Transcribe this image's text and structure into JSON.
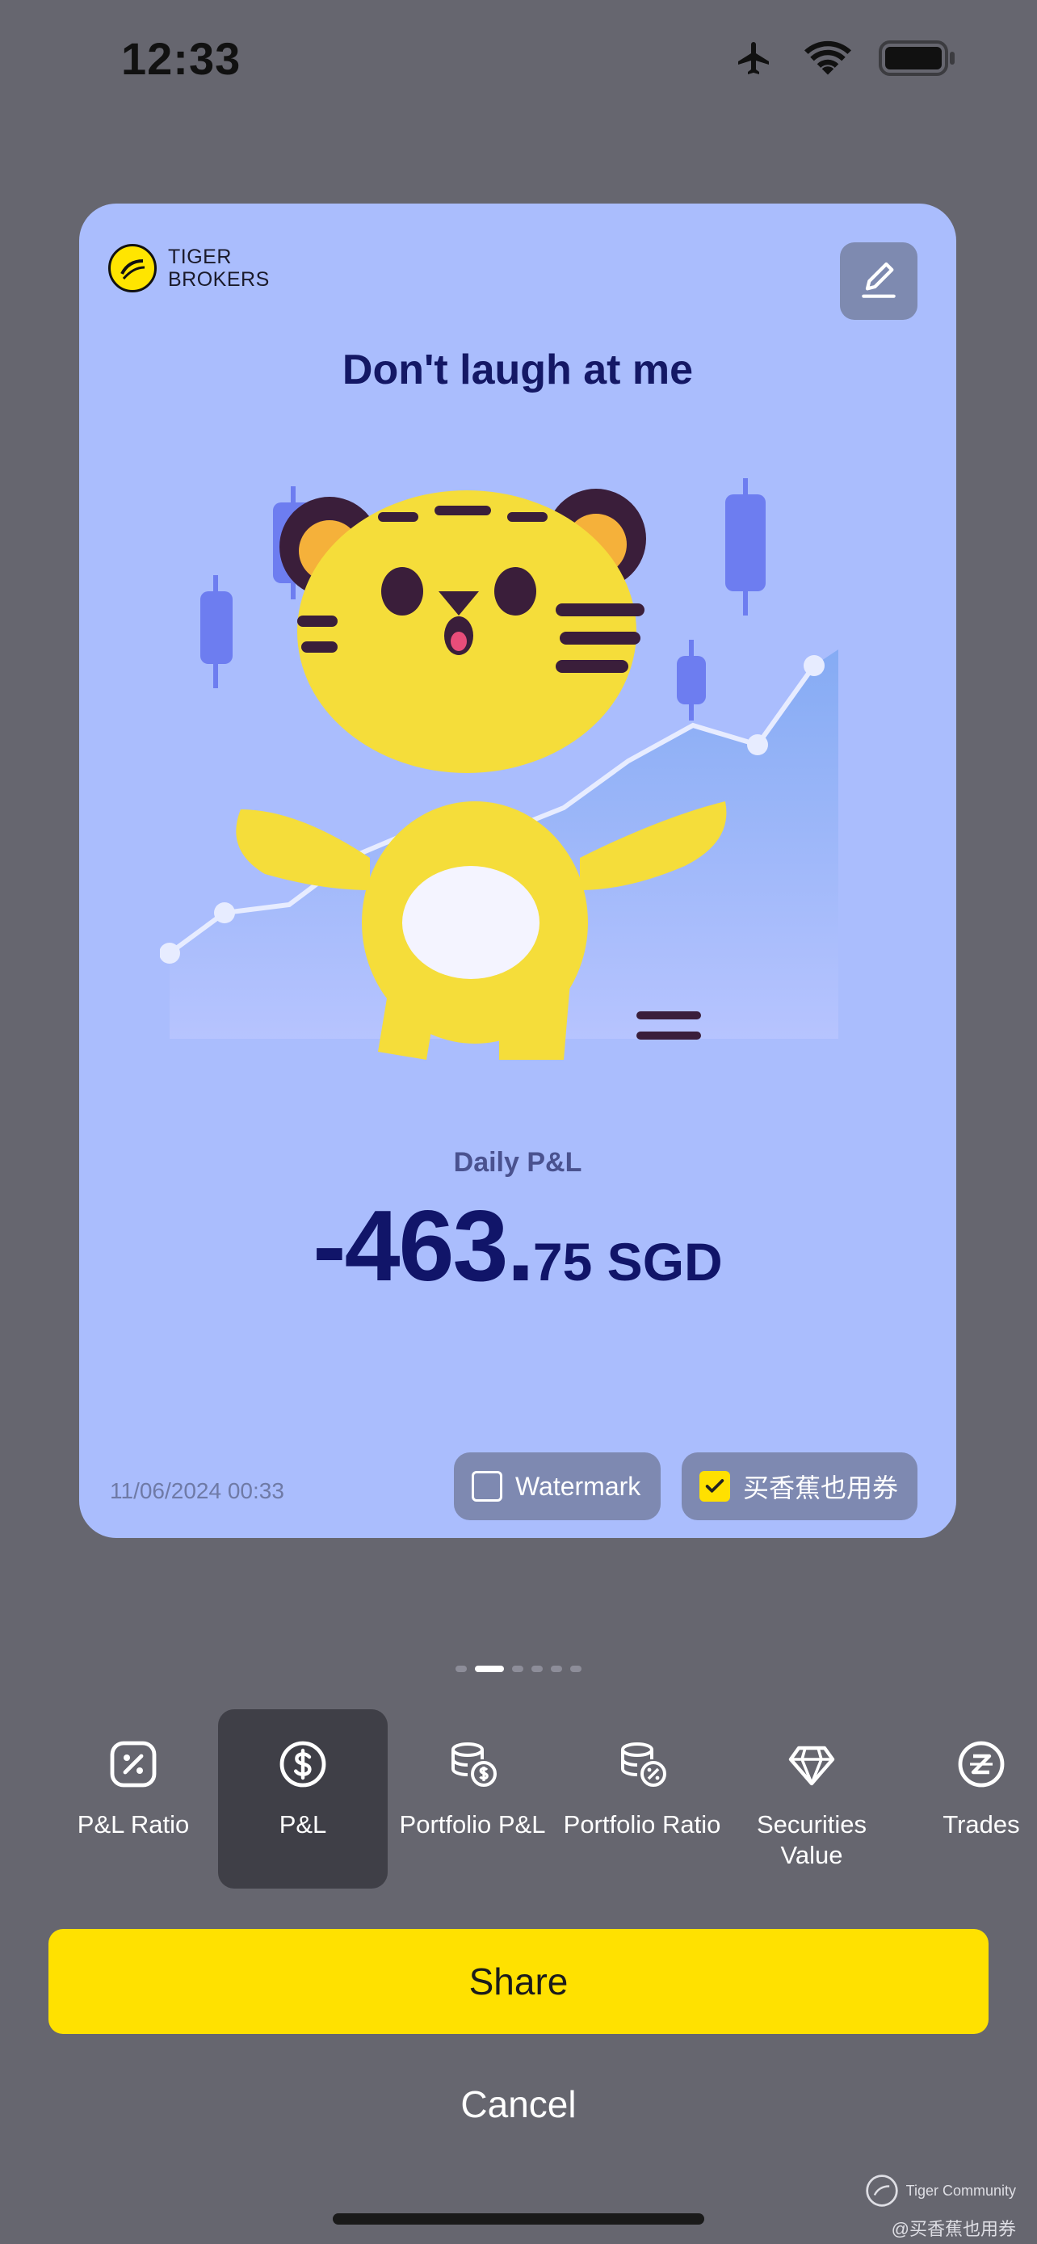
{
  "status_bar": {
    "time": "12:33"
  },
  "card": {
    "brand": {
      "line1": "TIGER",
      "line2": "BROKERS"
    },
    "title": "Don't laugh at me",
    "pl_label": "Daily P&L",
    "pl_integer": "-463.",
    "pl_decimal": "75 SGD",
    "date": "11/06/2024 00:33",
    "watermark": {
      "label": "Watermark",
      "checked": false
    },
    "banana": {
      "label": "买香蕉也用券",
      "checked": true
    }
  },
  "pager": {
    "count": 6,
    "active_index": 1
  },
  "tabs": [
    {
      "label": "P&L Ratio",
      "icon": "percent-icon"
    },
    {
      "label": "P&L",
      "icon": "dollar-icon"
    },
    {
      "label": "Portfolio P&L",
      "icon": "coins-dollar-icon"
    },
    {
      "label": "Portfolio Ratio",
      "icon": "coins-percent-icon"
    },
    {
      "label": "Securities Value",
      "icon": "diamond-icon"
    },
    {
      "label": "Trades",
      "icon": "trades-icon"
    }
  ],
  "actions": {
    "share": "Share",
    "cancel": "Cancel"
  },
  "community": {
    "name": "Tiger Community",
    "user": "@买香蕉也用券"
  },
  "colors": {
    "accent": "#ffe100",
    "card_bg": "#aabdfd",
    "title": "#141865"
  }
}
